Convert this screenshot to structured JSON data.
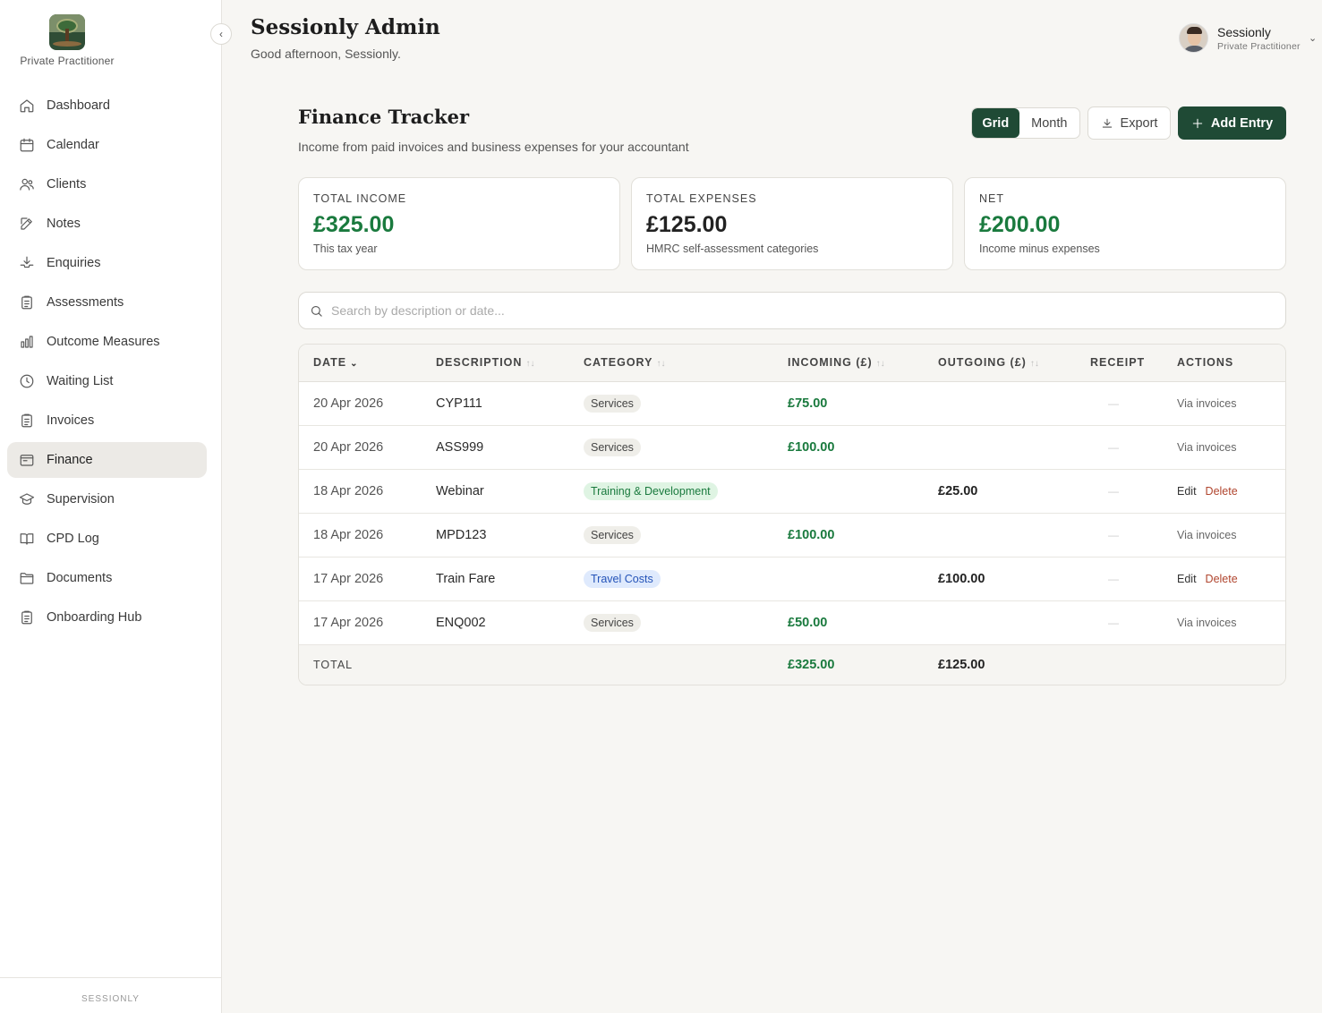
{
  "sidebar": {
    "org_role": "Private Practitioner",
    "items": [
      {
        "label": "Dashboard",
        "icon": "home-icon"
      },
      {
        "label": "Calendar",
        "icon": "calendar-icon"
      },
      {
        "label": "Clients",
        "icon": "users-icon"
      },
      {
        "label": "Notes",
        "icon": "edit-icon"
      },
      {
        "label": "Enquiries",
        "icon": "inbox-download-icon"
      },
      {
        "label": "Assessments",
        "icon": "clipboard-icon"
      },
      {
        "label": "Outcome Measures",
        "icon": "bar-chart-icon"
      },
      {
        "label": "Waiting List",
        "icon": "clock-icon"
      },
      {
        "label": "Invoices",
        "icon": "clipboard-icon"
      },
      {
        "label": "Finance",
        "icon": "wallet-icon",
        "active": true
      },
      {
        "label": "Supervision",
        "icon": "graduation-cap-icon"
      },
      {
        "label": "CPD Log",
        "icon": "book-open-icon"
      },
      {
        "label": "Documents",
        "icon": "folder-icon"
      },
      {
        "label": "Onboarding Hub",
        "icon": "clipboard-icon"
      }
    ],
    "footer": "SESSIONLY"
  },
  "header": {
    "title": "Sessionly Admin",
    "greeting": "Good afternoon, Sessionly.",
    "user": {
      "name": "Sessionly",
      "role": "Private Practitioner"
    }
  },
  "page": {
    "title": "Finance Tracker",
    "subtitle": "Income from paid invoices and business expenses for your accountant",
    "view_options": [
      "Grid",
      "Month"
    ],
    "selected_view": "Grid",
    "export_label": "Export",
    "add_label": "Add Entry"
  },
  "summary": [
    {
      "label": "TOTAL INCOME",
      "value": "£325.00",
      "note": "This tax year",
      "color": "#1a7a3e"
    },
    {
      "label": "TOTAL EXPENSES",
      "value": "£125.00",
      "note": "HMRC self-assessment categories",
      "color": "#222222"
    },
    {
      "label": "NET",
      "value": "£200.00",
      "note": "Income minus expenses",
      "color": "#1a7a3e"
    }
  ],
  "search": {
    "placeholder": "Search by description or date...",
    "value": ""
  },
  "table": {
    "headers": [
      "DATE",
      "DESCRIPTION",
      "CATEGORY",
      "INCOMING (£)",
      "OUTGOING (£)",
      "RECEIPT",
      "ACTIONS"
    ],
    "rows": [
      {
        "date": "20 Apr 2026",
        "description": "CYP111",
        "category": "Services",
        "incoming": "£75.00",
        "outgoing": "",
        "receipt": "—",
        "actions": "Via invoices"
      },
      {
        "date": "20 Apr 2026",
        "description": "ASS999",
        "category": "Services",
        "incoming": "£100.00",
        "outgoing": "",
        "receipt": "—",
        "actions": "Via invoices"
      },
      {
        "date": "18 Apr 2026",
        "description": "Webinar",
        "category": "Training & Development",
        "incoming": "",
        "outgoing": "£25.00",
        "receipt": "—",
        "actions": "edit-delete"
      },
      {
        "date": "18 Apr 2026",
        "description": "MPD123",
        "category": "Services",
        "incoming": "£100.00",
        "outgoing": "",
        "receipt": "—",
        "actions": "Via invoices"
      },
      {
        "date": "17 Apr 2026",
        "description": "Train Fare",
        "category": "Travel Costs",
        "incoming": "",
        "outgoing": "£100.00",
        "receipt": "—",
        "actions": "edit-delete"
      },
      {
        "date": "17 Apr 2026",
        "description": "ENQ002",
        "category": "Services",
        "incoming": "£50.00",
        "outgoing": "",
        "receipt": "—",
        "actions": "Via invoices"
      }
    ],
    "edit_label": "Edit",
    "delete_label": "Delete",
    "total": {
      "label": "TOTAL",
      "incoming": "£325.00",
      "outgoing": "£125.00"
    }
  }
}
